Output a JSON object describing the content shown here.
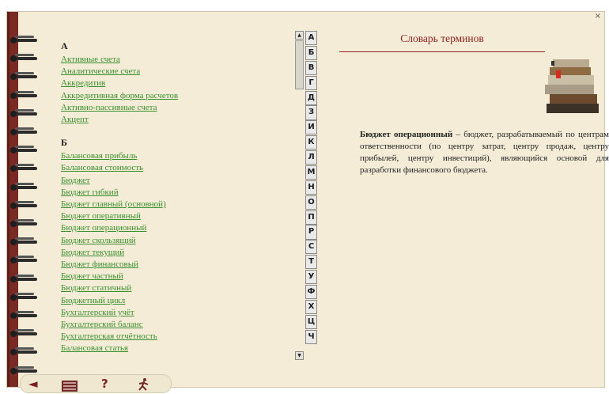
{
  "window": {
    "close_label": "×"
  },
  "glossary": {
    "title": "Словарь терминов",
    "sections": [
      {
        "letter": "А",
        "terms": [
          "Активные счета",
          "Аналитические счета",
          "Аккредитив",
          "Аккредитивная форма расчетов",
          "Активно-пассивные счета",
          "Акцепт"
        ]
      },
      {
        "letter": "Б",
        "terms": [
          "Балансовая прибыль",
          "Балансовая стоимость",
          "Бюджет",
          "Бюджет гибкий",
          "Бюджет главный (основной)",
          "Бюджет оперативный",
          "Бюджет операционный",
          "Бюджет скользящий",
          "Бюджет текущий",
          "Бюджет финансовый",
          "Бюджет частный",
          "Бюджет статичный",
          "Бюджетный цикл",
          "Бухгалтерский учёт",
          "Бухгалтерский баланс",
          "Бухгалтерская отчётность",
          "Балансовая статья"
        ]
      }
    ]
  },
  "alphabet": [
    "А",
    "Б",
    "В",
    "Г",
    "Д",
    "З",
    "И",
    "К",
    "Л",
    "М",
    "Н",
    "О",
    "П",
    "Р",
    "С",
    "Т",
    "У",
    "Ф",
    "Х",
    "Ц",
    "Ч"
  ],
  "definition": {
    "term": "Бюджет операционный",
    "text": " – бюджет, разрабатываемый по центрам ответственности (по центру затрат, центру продаж, центру прибылей, центру инвестиций), являющийся основой для разработки финансового бюджета."
  },
  "scrollbar": {
    "up": "▲",
    "down": "▼"
  },
  "bottom_bar": {
    "back": "◄",
    "help": "?"
  },
  "colors": {
    "spine": "#7a2a25",
    "link": "#3a8f2e",
    "title": "#8b1f1f",
    "page": "#f4ecd6"
  }
}
